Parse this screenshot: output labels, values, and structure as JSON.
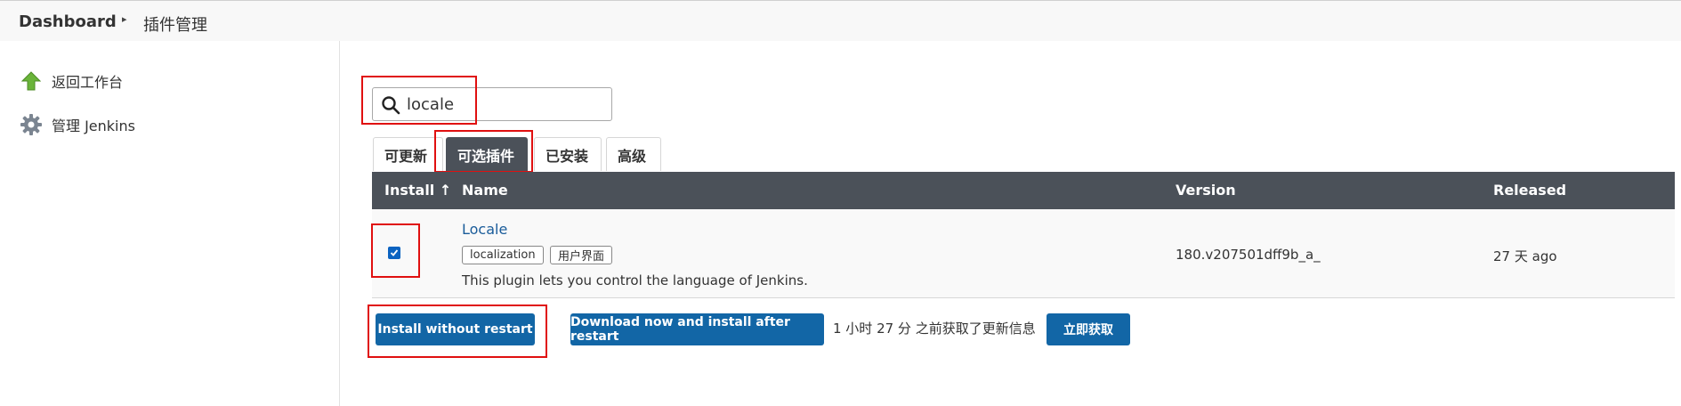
{
  "breadcrumb": {
    "home": "Dashboard",
    "separator": "▸",
    "current": "插件管理"
  },
  "sidebar": {
    "items": [
      {
        "label": "返回工作台",
        "icon": "up-arrow-icon"
      },
      {
        "label": "管理 Jenkins",
        "icon": "gear-icon"
      }
    ]
  },
  "search": {
    "value": "locale",
    "placeholder": ""
  },
  "tabs": [
    {
      "label": "可更新",
      "active": false
    },
    {
      "label": "可选插件",
      "active": true
    },
    {
      "label": "已安装",
      "active": false
    },
    {
      "label": "高级",
      "active": false
    }
  ],
  "table": {
    "headers": {
      "install": "Install  ↑",
      "name": "Name",
      "version": "Version",
      "released": "Released"
    },
    "rows": [
      {
        "checked": true,
        "name": "Locale",
        "tags": [
          "localization",
          "用户界面"
        ],
        "description": "This plugin lets you control the language of Jenkins.",
        "version": "180.v207501dff9b_a_",
        "released": "27 天 ago"
      }
    ]
  },
  "actions": {
    "install_without_restart": "Install without restart",
    "download_install_after_restart": "Download now and install after restart",
    "update_status": "1 小时 27 分 之前获取了更新信息",
    "fetch_now": "立即获取"
  },
  "colors": {
    "accent": "#1266a6",
    "header_dark": "#4b5159",
    "highlight": "#e01010",
    "link": "#1a5c9a"
  }
}
